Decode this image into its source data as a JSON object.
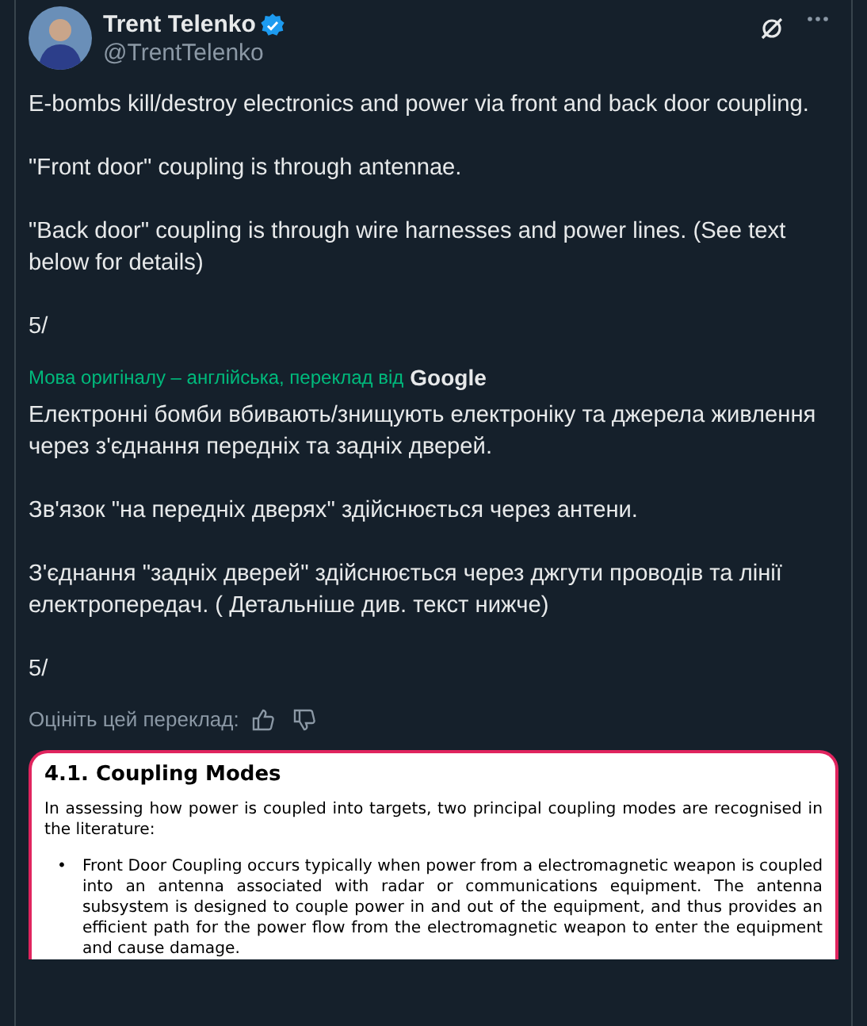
{
  "author": {
    "name": "Trent Telenko",
    "handle": "@TrentTelenko",
    "verified": true
  },
  "post_paragraphs": [
    "E-bombs kill/destroy electronics and power via front and back door coupling.",
    "\"Front door\" coupling is through antennae.",
    "\"Back door\" coupling is through wire harnesses and power lines.  (See text below for details)",
    "5/"
  ],
  "translation_note": {
    "text": "Мова оригіналу – англійська, переклад від",
    "provider": "Google"
  },
  "translated_paragraphs": [
    "Електронні бомби вбивають/знищують електроніку та джерела живлення через з'єднання передніх та задніх дверей.",
    "Зв'язок \"на передніх дверях\" здійснюється через антени.",
    "З'єднання \"задніх дверей\" здійснюється через джгути проводів та лінії електропередач.  ( Детальніше див. текст нижче)",
    "5/"
  ],
  "rate_label": "Оцініть цей переклад:",
  "document": {
    "heading": "4.1. Coupling Modes",
    "intro": "In assessing how power is coupled into targets, two principal coupling modes are recognised in the literature:",
    "bullet_marker": "•",
    "bullets": [
      "Front Door Coupling occurs typically when power from a electromagnetic weapon is coupled into an antenna associated with radar or communications equipment. The antenna subsystem is designed to couple power in and out of the equipment, and thus provides an efficient path for the power flow from the electromagnetic weapon to enter the equipment and cause damage."
    ]
  }
}
